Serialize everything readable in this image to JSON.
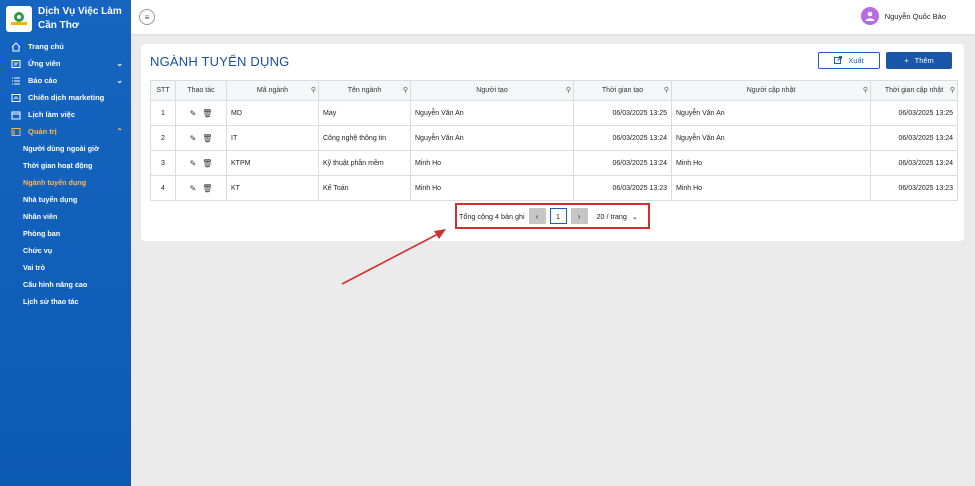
{
  "brand": {
    "title_line1": "Dịch Vụ Việc Làm",
    "title_line2": "Cần Thơ"
  },
  "sidebar": {
    "items": [
      {
        "label": "Trang chủ",
        "icon": "home-icon"
      },
      {
        "label": "Ứng viên",
        "icon": "user-card-icon"
      },
      {
        "label": "Báo cáo",
        "icon": "list-icon"
      },
      {
        "label": "Chiến dịch marketing",
        "icon": "campaign-icon"
      },
      {
        "label": "Lịch làm việc",
        "icon": "calendar-icon"
      },
      {
        "label": "Quản trị",
        "icon": "admin-icon"
      }
    ],
    "subitems": [
      "Người dùng ngoài giờ",
      "Thời gian hoạt động",
      "Ngành tuyển dụng",
      "Nhà tuyển dụng",
      "Nhân viên",
      "Phòng ban",
      "Chức vụ",
      "Vai trò",
      "Cấu hình nâng cao",
      "Lịch sử thao tác"
    ]
  },
  "header": {
    "user_name": "Nguyễn Quốc Bảo"
  },
  "main": {
    "title": "NGÀNH TUYỂN DỤNG",
    "export_label": "Xuất",
    "add_label": "Thêm",
    "columns": [
      "STT",
      "Thao tác",
      "Mã ngành",
      "Tên ngành",
      "Người tạo",
      "Thời gian tạo",
      "Người cập nhật",
      "Thời gian cập nhật"
    ],
    "rows": [
      {
        "stt": "1",
        "code": "MD",
        "name": "May",
        "creator": "Nguyễn Văn An",
        "created": "06/03/2025 13:25",
        "updater": "Nguyễn Văn An",
        "updated": "06/03/2025 13:25"
      },
      {
        "stt": "2",
        "code": "IT",
        "name": "Công nghệ thông tin",
        "creator": "Nguyễn Văn An",
        "created": "06/03/2025 13:24",
        "updater": "Nguyễn Văn An",
        "updated": "06/03/2025 13:24"
      },
      {
        "stt": "3",
        "code": "KTPM",
        "name": "Kỹ thuật phần mềm",
        "creator": "Minh Ho",
        "created": "06/03/2025 13:24",
        "updater": "Minh Ho",
        "updated": "06/03/2025 13:24"
      },
      {
        "stt": "4",
        "code": "KT",
        "name": "Kế Toán",
        "creator": "Minh Ho",
        "created": "06/03/2025 13:23",
        "updater": "Minh Ho",
        "updated": "06/03/2025 13:23"
      }
    ],
    "pagination": {
      "total_text": "Tổng cộng 4 bản ghi",
      "current_page": "1",
      "page_size": "20 / trang"
    }
  },
  "colors": {
    "sidebar": "#1565c0",
    "accent": "#ffb74d",
    "primary": "#1a56a8",
    "highlight": "#d32f2f"
  }
}
